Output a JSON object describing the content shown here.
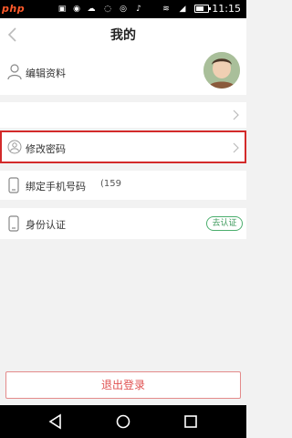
{
  "status_bar": {
    "watermark": "php",
    "time": "11:15",
    "battery_level": 0.7
  },
  "header": {
    "title": "我的"
  },
  "profile": {
    "label": "编辑资料"
  },
  "menu": {
    "change_password": "修改密码",
    "bind_phone": "绑定手机号码",
    "phone_value": "(159",
    "identity": "身份认证",
    "verify_badge": "去认证"
  },
  "logout": {
    "label": "退出登录"
  },
  "colors": {
    "highlight_border": "#d32a2a",
    "logout_text": "#e05050",
    "verify_green": "#3e9a5c"
  },
  "icons": [
    "back-icon",
    "person-icon",
    "chevron-right-icon",
    "user-circle-icon",
    "phone-icon",
    "back-triangle-icon",
    "home-circle-icon",
    "recents-square-icon"
  ]
}
